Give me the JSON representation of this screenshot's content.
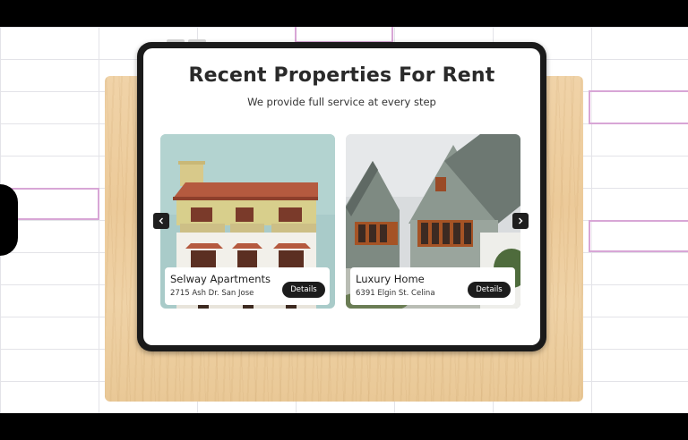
{
  "page": {
    "title": "Recent Properties For Rent",
    "subtitle": "We provide full service at every step"
  },
  "carousel": {
    "prev_icon": "chevron-left-icon",
    "next_icon": "chevron-right-icon"
  },
  "properties": [
    {
      "name": "Selway Apartments",
      "address": "2715 Ash Dr. San Jose",
      "button_label": "Details"
    },
    {
      "name": "Luxury Home",
      "address": "6391 Elgin St. Celina",
      "button_label": "Details"
    }
  ],
  "colors": {
    "accent": "#1c1c1c",
    "grid_highlight": "#d8a6d6",
    "wood": "#ecca99"
  }
}
